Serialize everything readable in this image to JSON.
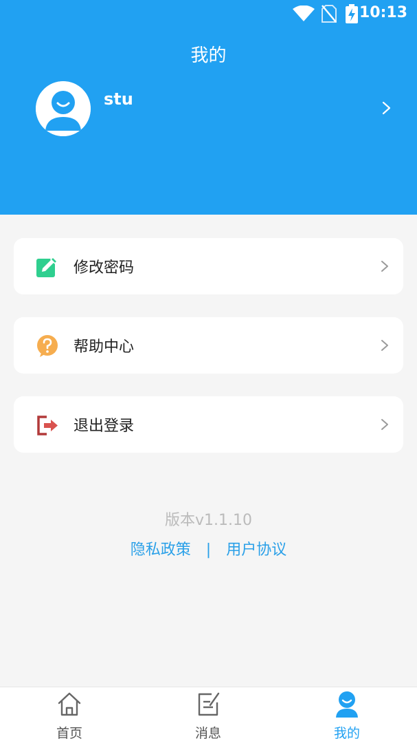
{
  "status_bar": {
    "time": "10:13"
  },
  "header": {
    "title": "我的"
  },
  "profile": {
    "username": "stu"
  },
  "menu": [
    {
      "label": "修改密码",
      "icon": "edit-icon",
      "color": "#2fcf8f"
    },
    {
      "label": "帮助中心",
      "icon": "help-icon",
      "color": "#f6ad4f"
    },
    {
      "label": "退出登录",
      "icon": "logout-icon",
      "color": "#b23a3a"
    }
  ],
  "footer": {
    "version": "版本v1.1.10",
    "privacy_link": "隐私政策",
    "separator": "|",
    "agreement_link": "用户协议"
  },
  "bottom_nav": [
    {
      "label": "首页",
      "icon": "home-icon",
      "active": false
    },
    {
      "label": "消息",
      "icon": "message-icon",
      "active": false
    },
    {
      "label": "我的",
      "icon": "profile-icon",
      "active": true
    }
  ],
  "colors": {
    "primary": "#21a1f2",
    "background": "#f5f5f5",
    "link": "#2aa0e8"
  }
}
